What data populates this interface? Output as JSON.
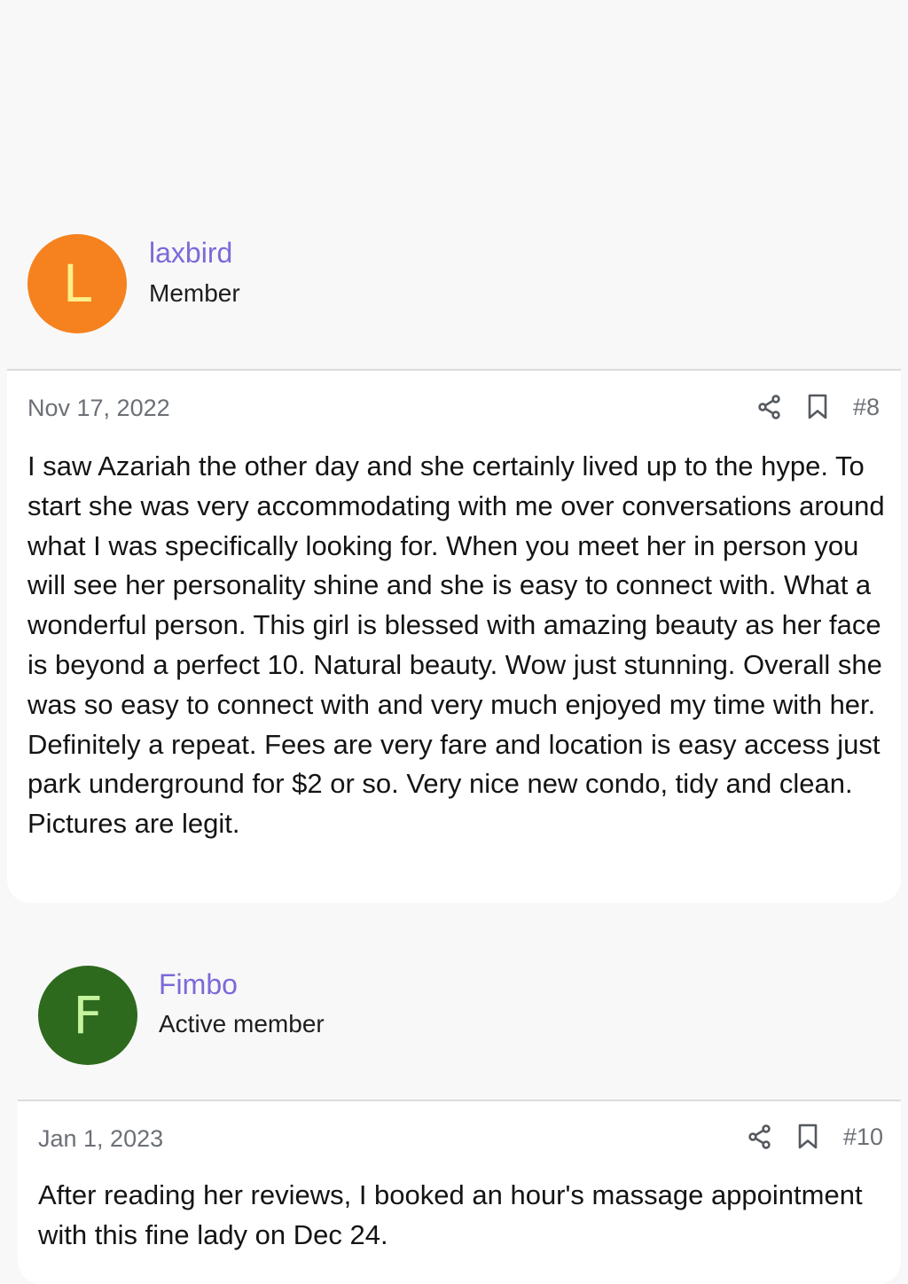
{
  "posts": [
    {
      "avatar_letter": "L",
      "avatar_color": "#f5821e",
      "avatar_text_color": "#fcef8a",
      "username": "laxbird",
      "user_title": "Member",
      "date": "Nov 17, 2022",
      "post_number": "#8",
      "icons": [
        "share-icon",
        "bookmark-icon"
      ],
      "body": "I saw Azariah the other day and she certainly lived up to the hype. To start she was very accommodating with me over conversations around what I was specifically looking for. When you meet her in person you will see her personality shine and she is easy to connect with. What a wonderful person. This girl is blessed with amazing beauty as her face is beyond a perfect 10. Natural beauty. Wow just stunning. Overall she was so easy to connect with and very much enjoyed my time with her. Definitely a repeat. Fees are very fare and location is easy access just park underground for $2 or so. Very nice new condo, tidy and clean. Pictures are legit."
    },
    {
      "avatar_letter": "F",
      "avatar_color": "#2e6a1d",
      "avatar_text_color": "#c5f39e",
      "username": "Fimbo",
      "user_title": "Active member",
      "date": "Jan 1, 2023",
      "post_number": "#10",
      "icons": [
        "share-icon",
        "bookmark-icon"
      ],
      "body": "After reading her reviews, I booked an hour's massage appointment with this fine lady on Dec 24."
    }
  ],
  "colors": {
    "page_background": "#f8f8f9",
    "card_background": "#ffffff",
    "username_link": "#7b6ad8",
    "meta_text": "#6c7076"
  }
}
